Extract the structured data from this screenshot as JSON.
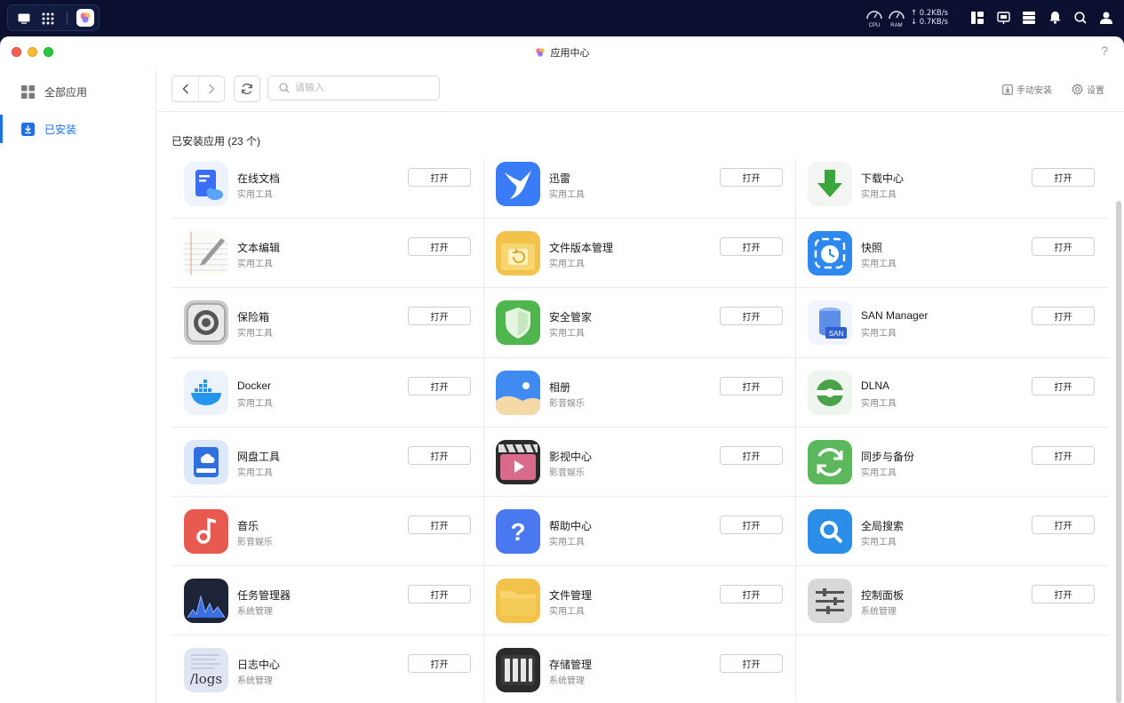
{
  "sysbar": {
    "cpu_label": "CPU",
    "ram_label": "RAM",
    "upload_rate": "0.2KB/s",
    "download_rate": "0.7KB/s"
  },
  "window": {
    "title": "应用中心",
    "help": "?"
  },
  "sidebar": {
    "items": [
      {
        "label": "全部应用",
        "icon": "grid-icon"
      },
      {
        "label": "已安装",
        "icon": "download-icon"
      }
    ]
  },
  "toolbar": {
    "search_placeholder": "请输入",
    "manual_install": "手动安装",
    "settings": "设置"
  },
  "section_title": "已安装应用 (23 个)",
  "open_label": "打开",
  "apps": [
    {
      "name": "在线文档",
      "category": "实用工具",
      "icon": "docs-icon"
    },
    {
      "name": "迅雷",
      "category": "实用工具",
      "icon": "thunder-icon"
    },
    {
      "name": "下载中心",
      "category": "实用工具",
      "icon": "download-center-icon"
    },
    {
      "name": "文本编辑",
      "category": "实用工具",
      "icon": "text-editor-icon"
    },
    {
      "name": "文件版本管理",
      "category": "实用工具",
      "icon": "file-version-icon"
    },
    {
      "name": "快照",
      "category": "实用工具",
      "icon": "snapshot-icon"
    },
    {
      "name": "保险箱",
      "category": "实用工具",
      "icon": "safe-icon"
    },
    {
      "name": "安全管家",
      "category": "实用工具",
      "icon": "security-shield-icon"
    },
    {
      "name": "SAN Manager",
      "category": "实用工具",
      "icon": "san-manager-icon"
    },
    {
      "name": "Docker",
      "category": "实用工具",
      "icon": "docker-icon"
    },
    {
      "name": "相册",
      "category": "影音娱乐",
      "icon": "photos-icon"
    },
    {
      "name": "DLNA",
      "category": "实用工具",
      "icon": "dlna-icon"
    },
    {
      "name": "网盘工具",
      "category": "实用工具",
      "icon": "cloud-drive-icon"
    },
    {
      "name": "影视中心",
      "category": "影音娱乐",
      "icon": "video-center-icon"
    },
    {
      "name": "同步与备份",
      "category": "实用工具",
      "icon": "sync-backup-icon"
    },
    {
      "name": "音乐",
      "category": "影音娱乐",
      "icon": "music-icon"
    },
    {
      "name": "帮助中心",
      "category": "实用工具",
      "icon": "help-center-icon"
    },
    {
      "name": "全局搜索",
      "category": "实用工具",
      "icon": "global-search-icon"
    },
    {
      "name": "任务管理器",
      "category": "系统管理",
      "icon": "task-manager-icon"
    },
    {
      "name": "文件管理",
      "category": "实用工具",
      "icon": "file-manager-icon"
    },
    {
      "name": "控制面板",
      "category": "系统管理",
      "icon": "control-panel-icon"
    },
    {
      "name": "日志中心",
      "category": "系统管理",
      "icon": "log-center-icon",
      "icon_text": "/logs"
    },
    {
      "name": "存储管理",
      "category": "系统管理",
      "icon": "storage-manager-icon"
    }
  ]
}
